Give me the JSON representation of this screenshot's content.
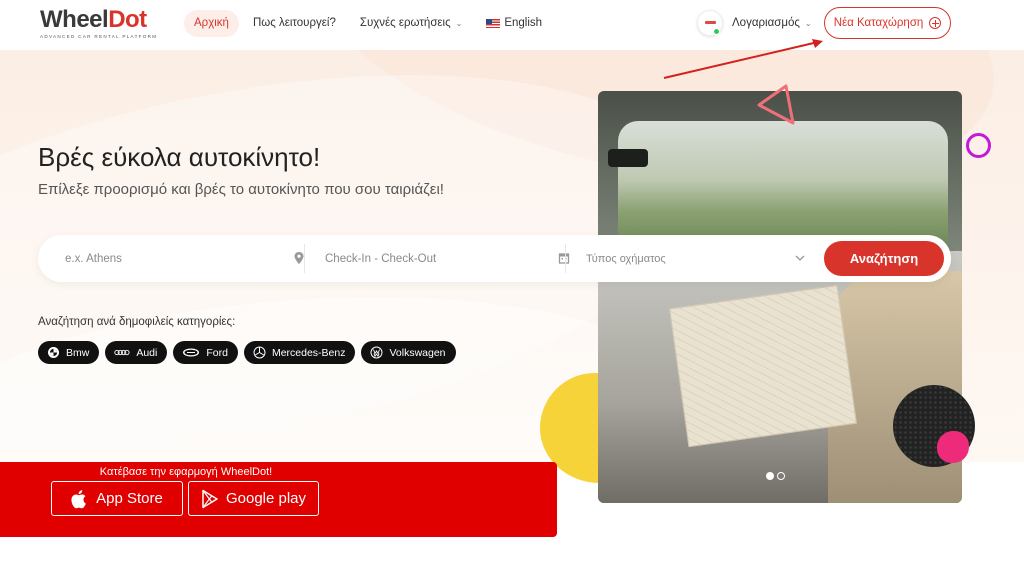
{
  "header": {
    "logo": {
      "word_a": "Wheel",
      "word_b": "Dot",
      "tagline": "ADVANCED CAR RENTAL PLATFORM"
    },
    "nav": [
      {
        "label": "Αρχική"
      },
      {
        "label": "Πως λειτουργεί?"
      },
      {
        "label": "Συχνές ερωτήσεις"
      },
      {
        "label": "English"
      }
    ],
    "account_label": "Λογαριασμός",
    "new_listing_label": "Νέα Καταχώρηση"
  },
  "hero": {
    "title": "Βρές εύκολα αυτοκίνητο!",
    "subtitle": "Επίλεξε προορισμό και βρές το αυτοκίνητο που σου ταιριάζει!"
  },
  "search": {
    "location_placeholder": "e.x. Athens",
    "dates_placeholder": "Check-In - Check-Out",
    "vehicle_type_placeholder": "Τύπος οχήματος",
    "button_label": "Αναζήτηση"
  },
  "categories": {
    "label": "Αναζήτηση ανά δημοφιλείς κατηγορίες:",
    "items": [
      {
        "label": "Bmw",
        "icon": "bmw-logo-icon"
      },
      {
        "label": "Audi",
        "icon": "audi-logo-icon"
      },
      {
        "label": "Ford",
        "icon": "ford-logo-icon"
      },
      {
        "label": "Mercedes-Benz",
        "icon": "mercedes-logo-icon"
      },
      {
        "label": "Volkswagen",
        "icon": "volkswagen-logo-icon"
      }
    ]
  },
  "app_banner": {
    "caption": "Κατέβασε την εφαρμογή WheelDot!",
    "app_store_label": "App Store",
    "google_play_label": "Google play"
  },
  "colors": {
    "brand_red": "#d9342b",
    "banner_red": "#e00000",
    "accent_purple": "#c21bd6",
    "accent_yellow": "#f7d33a",
    "accent_pink": "#ee2a7b"
  }
}
